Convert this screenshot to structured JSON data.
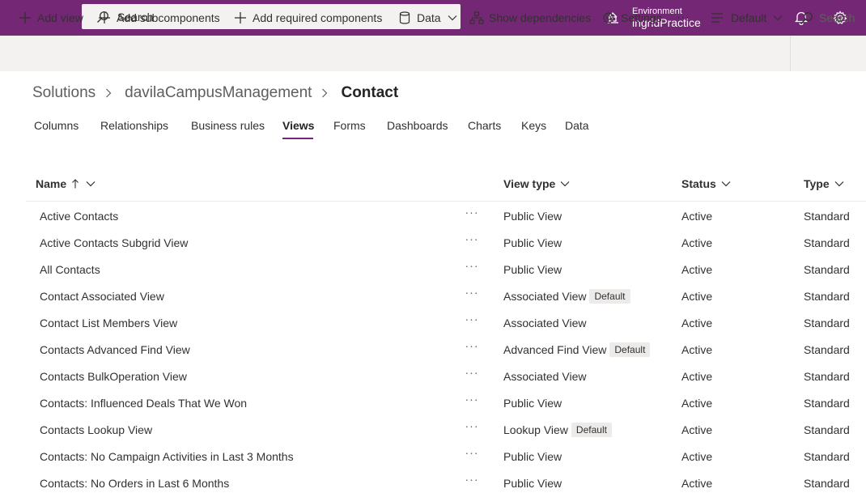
{
  "topbar": {
    "search_placeholder": "Search",
    "environment_label": "Environment",
    "environment_name": "ingridPractice",
    "color": "#742774"
  },
  "commands": {
    "add_view": "Add view",
    "add_subcomponents": "Add subcomponents",
    "add_required_components": "Add required components",
    "data": "Data",
    "show_dependencies": "Show dependencies",
    "settings": "Settings",
    "more": "···",
    "view_selector": "Default",
    "search": "Search"
  },
  "breadcrumb": {
    "root": "Solutions",
    "solution": "davilaCampusManagement",
    "current": "Contact"
  },
  "tabs": [
    "Columns",
    "Relationships",
    "Business rules",
    "Views",
    "Forms",
    "Dashboards",
    "Charts",
    "Keys",
    "Data"
  ],
  "active_tab": "Views",
  "table": {
    "headers": {
      "name": "Name",
      "view_type": "View type",
      "status": "Status",
      "type": "Type"
    },
    "more_label": "···",
    "rows": [
      {
        "name": "Active Contacts",
        "view_type": "Public View",
        "badge": "",
        "status": "Active",
        "type": "Standard"
      },
      {
        "name": "Active Contacts Subgrid View",
        "view_type": "Public View",
        "badge": "",
        "status": "Active",
        "type": "Standard"
      },
      {
        "name": "All Contacts",
        "view_type": "Public View",
        "badge": "",
        "status": "Active",
        "type": "Standard"
      },
      {
        "name": "Contact Associated View",
        "view_type": "Associated View",
        "badge": "Default",
        "status": "Active",
        "type": "Standard"
      },
      {
        "name": "Contact List Members View",
        "view_type": "Associated View",
        "badge": "",
        "status": "Active",
        "type": "Standard"
      },
      {
        "name": "Contacts Advanced Find View",
        "view_type": "Advanced Find View",
        "badge": "Default",
        "status": "Active",
        "type": "Standard"
      },
      {
        "name": "Contacts BulkOperation View",
        "view_type": "Associated View",
        "badge": "",
        "status": "Active",
        "type": "Standard"
      },
      {
        "name": "Contacts: Influenced Deals That We Won",
        "view_type": "Public View",
        "badge": "",
        "status": "Active",
        "type": "Standard"
      },
      {
        "name": "Contacts Lookup View",
        "view_type": "Lookup View",
        "badge": "Default",
        "status": "Active",
        "type": "Standard"
      },
      {
        "name": "Contacts: No Campaign Activities in Last 3 Months",
        "view_type": "Public View",
        "badge": "",
        "status": "Active",
        "type": "Standard"
      },
      {
        "name": "Contacts: No Orders in Last 6 Months",
        "view_type": "Public View",
        "badge": "",
        "status": "Active",
        "type": "Standard"
      }
    ]
  }
}
